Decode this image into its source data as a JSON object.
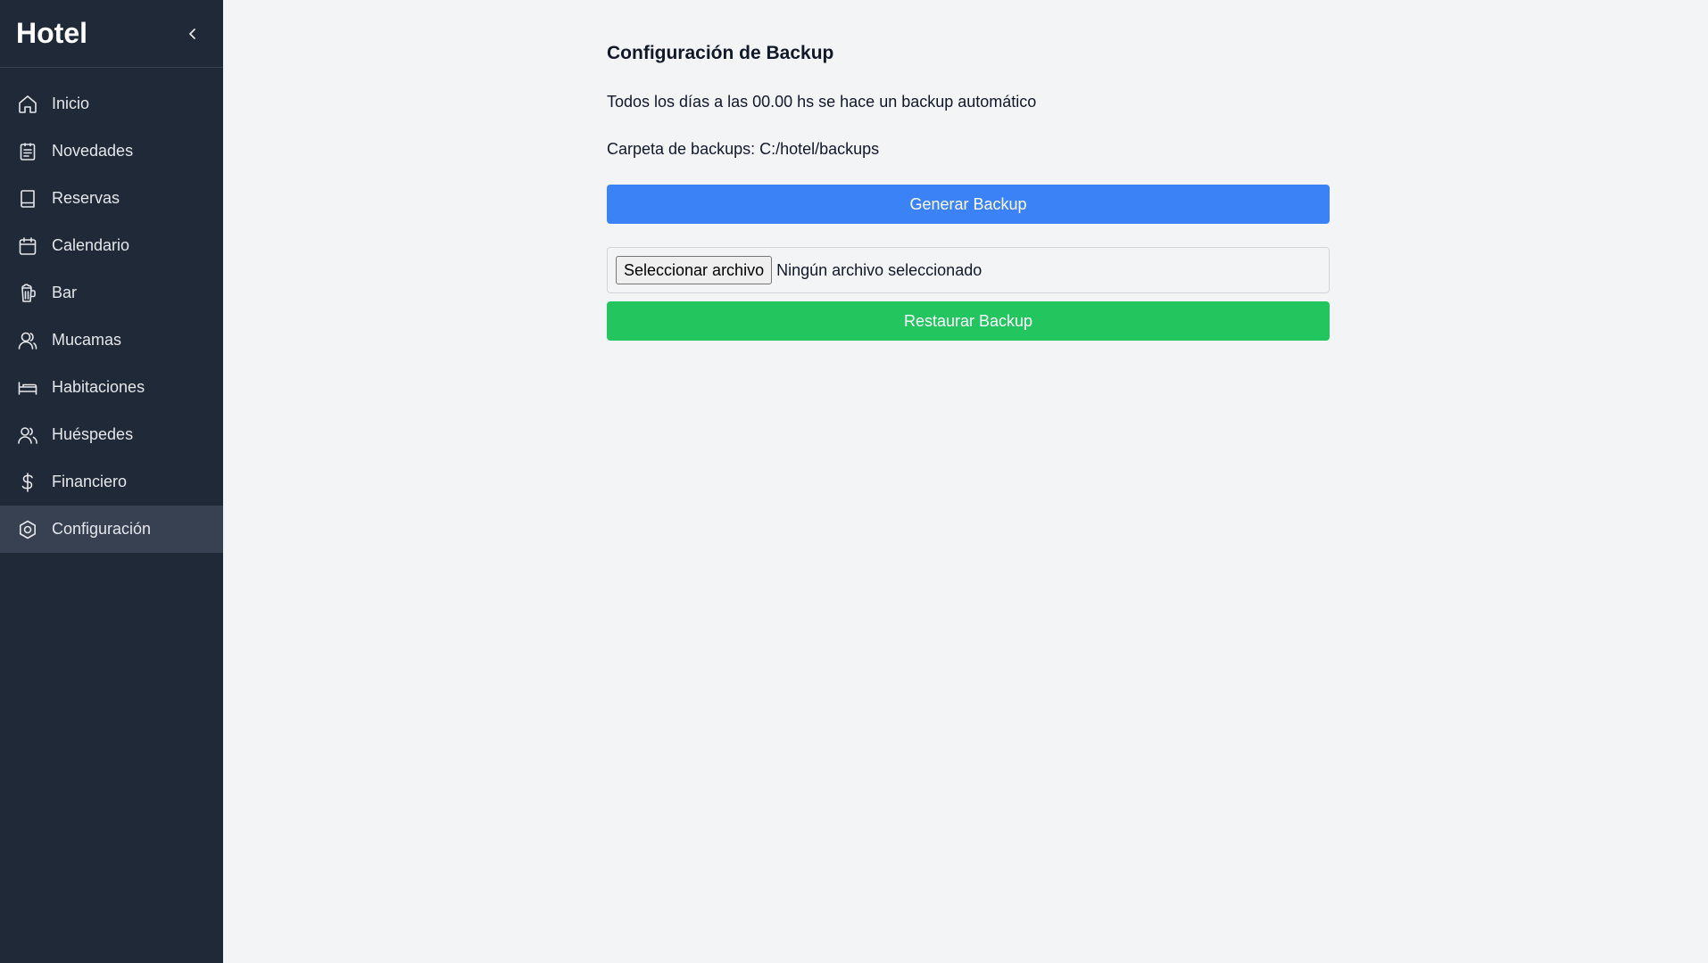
{
  "app": {
    "brand": "Hotel"
  },
  "sidebar": {
    "items": [
      {
        "label": "Inicio",
        "icon": "home-icon"
      },
      {
        "label": "Novedades",
        "icon": "clipboard-icon"
      },
      {
        "label": "Reservas",
        "icon": "book-icon"
      },
      {
        "label": "Calendario",
        "icon": "calendar-icon"
      },
      {
        "label": "Bar",
        "icon": "glass-icon"
      },
      {
        "label": "Mucamas",
        "icon": "user-icon"
      },
      {
        "label": "Habitaciones",
        "icon": "bed-icon"
      },
      {
        "label": "Huéspedes",
        "icon": "users-icon"
      },
      {
        "label": "Financiero",
        "icon": "dollar-icon"
      },
      {
        "label": "Configuración",
        "icon": "settings-icon",
        "active": true
      }
    ]
  },
  "main": {
    "title": "Configuración de Backup",
    "schedule_text": "Todos los días a las 00.00 hs se hace un backup automático",
    "folder_text": "Carpeta de backups: C:/hotel/backups",
    "generate_label": "Generar Backup",
    "file_button_label": "Seleccionar archivo",
    "file_status": "Ningún archivo seleccionado",
    "restore_label": "Restaurar Backup"
  },
  "colors": {
    "sidebar_bg": "#1f2937",
    "sidebar_active": "#374151",
    "page_bg": "#f3f4f6",
    "primary": "#3b82f6",
    "success": "#22c55e"
  }
}
